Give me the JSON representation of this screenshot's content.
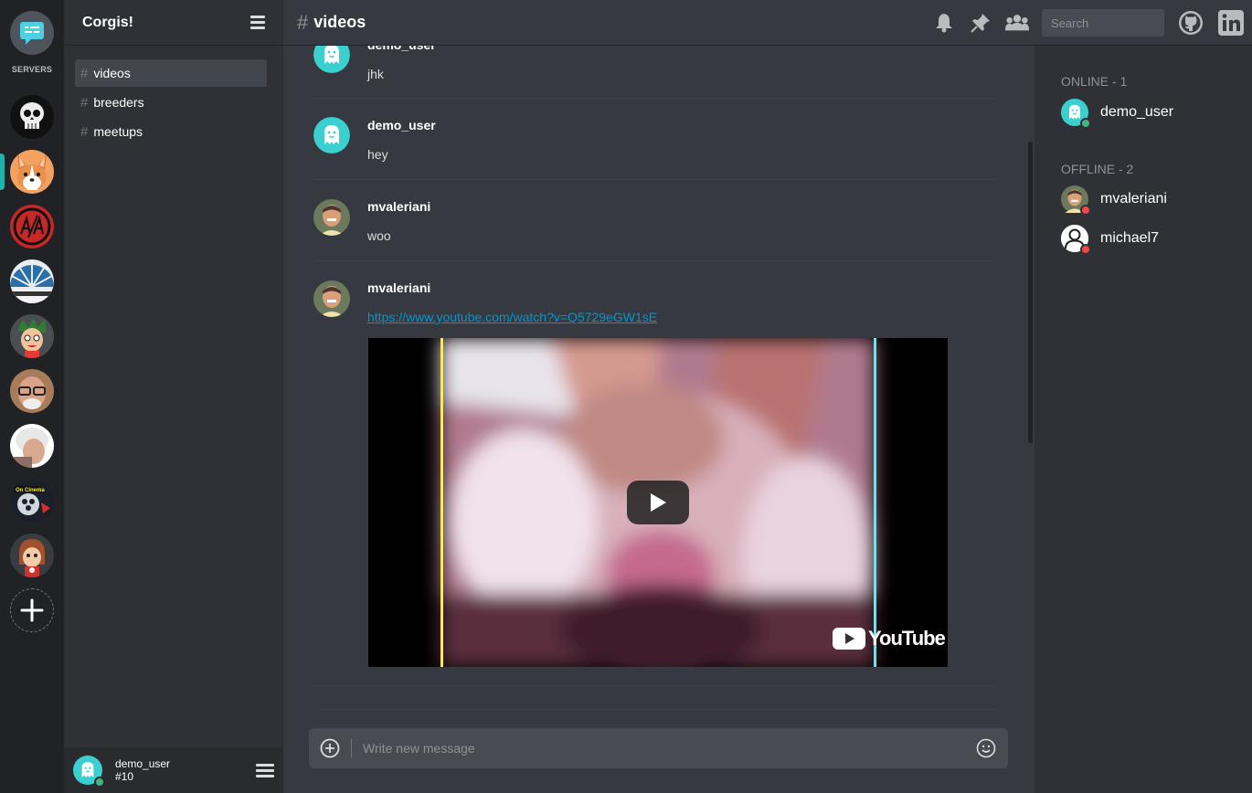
{
  "rail": {
    "servers_label": "SERVERS",
    "servers": [
      {
        "name": "skull-server",
        "icon": "skull-icon"
      },
      {
        "name": "corgis-server",
        "icon": "corgi-icon",
        "active": true
      },
      {
        "name": "aa-server",
        "icon": "aa-logo-icon"
      },
      {
        "name": "waking-up-server",
        "icon": "waking-up-logo-icon"
      },
      {
        "name": "cartoon-boy-server",
        "icon": "cartoon-face-icon"
      },
      {
        "name": "glasses-man-server",
        "icon": "portrait-icon"
      },
      {
        "name": "old-woman-server",
        "icon": "portrait-icon"
      },
      {
        "name": "on-cinema-server",
        "icon": "on-cinema-logo-icon"
      },
      {
        "name": "cartoon-girl-server",
        "icon": "cartoon-face-icon"
      }
    ],
    "accent": "#20b2aa"
  },
  "sidebar": {
    "server_name": "Corgis!",
    "channels": [
      {
        "name": "videos",
        "active": true
      },
      {
        "name": "breeders"
      },
      {
        "name": "meetups"
      }
    ],
    "user": {
      "name": "demo_user",
      "tag": "#10",
      "status": "online"
    }
  },
  "header": {
    "channel": "videos",
    "search_placeholder": "Search",
    "icons": [
      "bell-icon",
      "pin-icon",
      "members-icon",
      "github-icon",
      "linkedin-icon"
    ]
  },
  "messages": [
    {
      "author": "demo_user",
      "text": "jhk",
      "avatar": "ghost-avatar"
    },
    {
      "author": "demo_user",
      "text": "hey",
      "avatar": "ghost-avatar"
    },
    {
      "author": "mvaleriani",
      "text": "woo",
      "avatar": "photo-avatar"
    },
    {
      "author": "mvaleriani",
      "link": "https://www.youtube.com/watch?v=Q5729eGW1sE",
      "avatar": "photo-avatar",
      "embed": {
        "provider": "YouTube"
      }
    }
  ],
  "composer": {
    "placeholder": "Write new message"
  },
  "members": {
    "online_label": "ONLINE - 1",
    "offline_label": "OFFLINE - 2",
    "online": [
      {
        "name": "demo_user",
        "status_color": "#43b581"
      }
    ],
    "offline": [
      {
        "name": "mvaleriani",
        "status_color": "#f04747"
      },
      {
        "name": "michael7",
        "status_color": "#f04747"
      }
    ]
  },
  "colors": {
    "online": "#43b581",
    "offline": "#f04747",
    "link": "#0096cf",
    "ghost": "#3ccfcf"
  }
}
